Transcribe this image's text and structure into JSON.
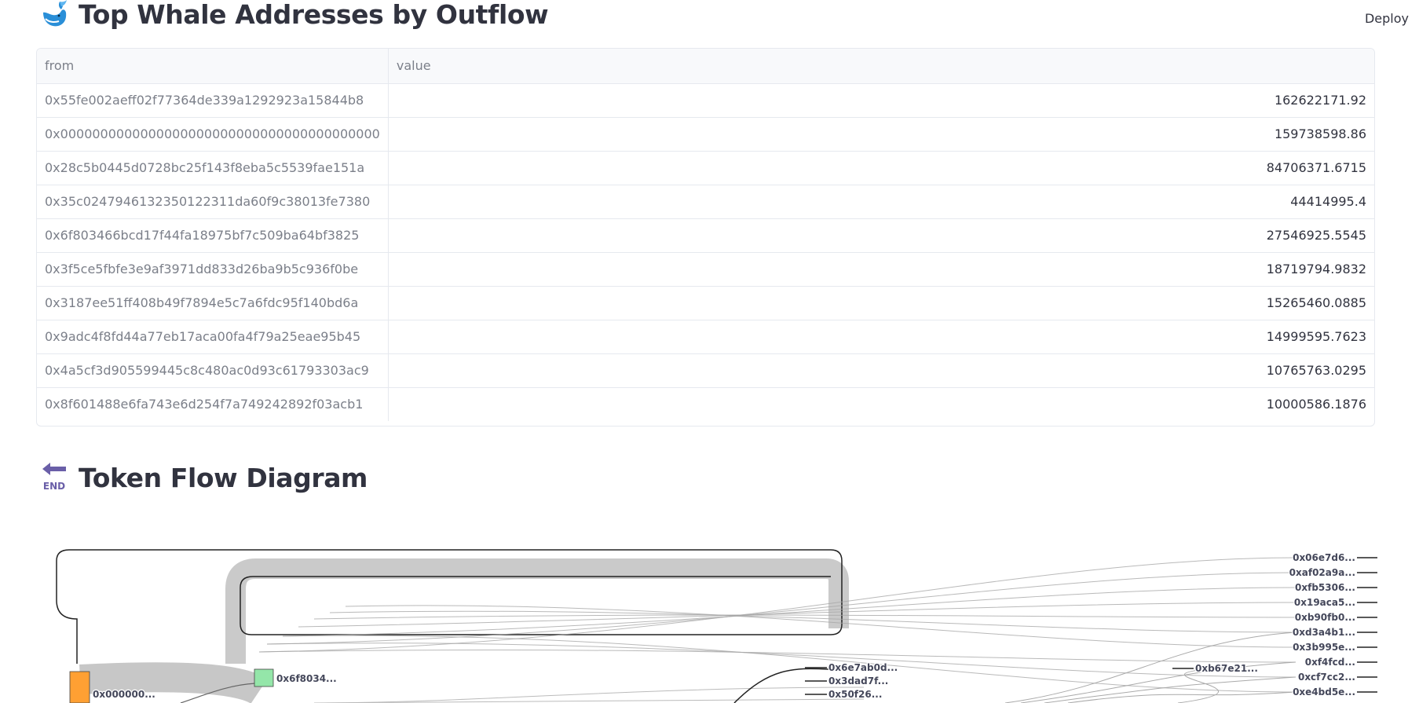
{
  "header": {
    "deploy_label": "Deploy"
  },
  "whale_section": {
    "title": "Top Whale Addresses by Outflow",
    "icon": "whale-icon",
    "columns": [
      "from",
      "value"
    ],
    "rows": [
      {
        "from": "0x55fe002aeff02f77364de339a1292923a15844b8",
        "value": "162622171.92"
      },
      {
        "from": "0x0000000000000000000000000000000000000000",
        "value": "159738598.86"
      },
      {
        "from": "0x28c5b0445d0728bc25f143f8eba5c5539fae151a",
        "value": "84706371.6715"
      },
      {
        "from": "0x35c0247946132350122311da60f9c38013fe7380",
        "value": "44414995.4"
      },
      {
        "from": "0x6f803466bcd17f44fa18975bf7c509ba64bf3825",
        "value": "27546925.5545"
      },
      {
        "from": "0x3f5ce5fbfe3e9af3971dd833d26ba9b5c936f0be",
        "value": "18719794.9832"
      },
      {
        "from": "0x3187ee51ff408b49f7894e5c7a6fdc95f140bd6a",
        "value": "15265460.0885"
      },
      {
        "from": "0x9adc4f8fd44a77eb17aca00fa4f79a25eae95b45",
        "value": "14999595.7623"
      },
      {
        "from": "0x4a5cf3d905599445c8c480ac0d93c61793303ac9",
        "value": "10765763.0295"
      },
      {
        "from": "0x8f601488e6fa743e6d254f7a749242892f03acb1",
        "value": "10000586.1876"
      }
    ]
  },
  "flow_section": {
    "title": "Token Flow Diagram",
    "icon": "end-arrow-icon",
    "source_labels": [
      "0x000000...",
      "0x6f8034..."
    ],
    "mid_labels": [
      "0x6e7ab0d...",
      "0x3dad7f...",
      "0x50f26...",
      "0xb67e21..."
    ],
    "right_labels": [
      "0x06e7d6...",
      "0xaf02a9a...",
      "0xfb5306...",
      "0x19aca5...",
      "0xb90fb0...",
      "0xd3a4b1...",
      "0x3b995e...",
      "0xf4fcd...",
      "0xcf7cc2...",
      "0xe4bd5e..."
    ],
    "colors": {
      "source_orange": "#ffa033",
      "source_green": "#94e6a9",
      "link_gray": "#b4b4b4"
    }
  }
}
